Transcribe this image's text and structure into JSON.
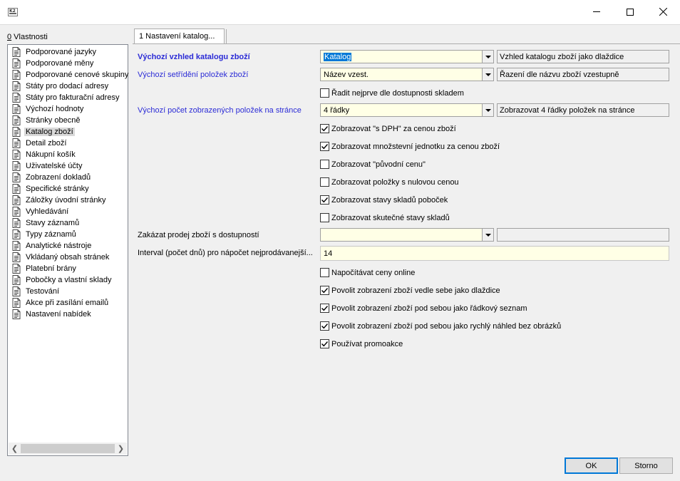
{
  "window": {
    "app_icon_text": "K2"
  },
  "left_panel": {
    "title_prefix": "0",
    "title": " Vlastnosti",
    "items": [
      "Podporované jazyky",
      "Podporované měny",
      "Podporované cenové skupiny",
      "Státy pro dodací adresy",
      "Státy pro fakturační adresy",
      "Výchozí hodnoty",
      "Stránky obecně",
      "Katalog zboží",
      "Detail zboží",
      "Nákupní košík",
      "Uživatelské účty",
      "Zobrazení dokladů",
      "Specifické stránky",
      "Záložky úvodní stránky",
      "Vyhledávání",
      "Stavy záznamů",
      "Typy záznamů",
      "Analytické nástroje",
      "Vkládaný obsah stránek",
      "Platební brány",
      "Pobočky a vlastní sklady",
      "Testování",
      "Akce při zasílání emailů",
      "Nastavení nabídek"
    ],
    "selected_index": 7
  },
  "tab": {
    "label": "1 Nastavení katalog..."
  },
  "fields": {
    "vzhled": {
      "label": "Výchozí vzhled katalogu zboží",
      "value": "Katalog",
      "description": "Vzhled katalogu zboží jako dlaždice"
    },
    "trideni": {
      "label": "Výchozí setřídění položek zboží",
      "value": "Název vzest.",
      "description": "Řazení dle názvu zboží vzestupně"
    },
    "pocet": {
      "label": "Výchozí počet zobrazených položek na stránce",
      "value": "4 řádky",
      "description": "Zobrazovat 4 řádky položek na stránce"
    },
    "zakazat": {
      "label": "Zakázat prodej zboží s dostupností",
      "value": "",
      "description": ""
    },
    "interval": {
      "label": "Interval (počet dnů) pro nápočet nejprodávanejší...",
      "value": "14"
    }
  },
  "checkboxes": {
    "radit": {
      "label": "Řadit nejprve dle dostupnosti skladem",
      "checked": false
    },
    "s_dph": {
      "label": "Zobrazovat \"s DPH\" za cenou zboží",
      "checked": true
    },
    "mj": {
      "label": "Zobrazovat množstevní jednotku za cenou zboží",
      "checked": true
    },
    "puvodni": {
      "label": "Zobrazovat \"původní cenu\"",
      "checked": false
    },
    "nulova": {
      "label": "Zobrazovat položky s nulovou cenou",
      "checked": false
    },
    "stavy_pobocek": {
      "label": "Zobrazovat stavy skladů poboček",
      "checked": true
    },
    "skutecne": {
      "label": "Zobrazovat skutečné stavy skladů",
      "checked": false
    },
    "online": {
      "label": "Napočítávat ceny online",
      "checked": false
    },
    "dlazdice": {
      "label": "Povolit zobrazení zboží vedle sebe jako dlaždice",
      "checked": true
    },
    "radkovy": {
      "label": "Povolit zobrazení zboží pod sebou jako řádkový seznam",
      "checked": true
    },
    "rychly": {
      "label": "Povolit zobrazení zboží pod sebou jako rychlý náhled bez obrázků",
      "checked": true
    },
    "promo": {
      "label": "Používat promoakce",
      "checked": true
    }
  },
  "buttons": {
    "ok": "OK",
    "storno": "Storno"
  }
}
